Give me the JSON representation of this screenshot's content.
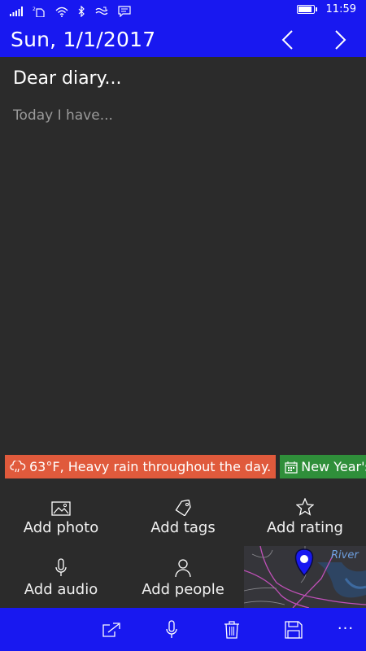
{
  "status_bar": {
    "time": "11:59",
    "icons": [
      "signal-icon",
      "sim-icon",
      "wifi-icon",
      "bluetooth-icon",
      "data-sense-icon",
      "message-icon",
      "battery-icon"
    ]
  },
  "header": {
    "date": "Sun, 1/1/2017",
    "prev_icon": "chevron-left-icon",
    "next_icon": "chevron-right-icon",
    "accent": "#1818f0"
  },
  "entry": {
    "title_placeholder": "Dear diary...",
    "body_placeholder": "Today I have..."
  },
  "chips": {
    "weather": "63°F, Heavy rain throughout the day.",
    "weather_color": "#e05a3c",
    "holiday": "New Year's Day",
    "holiday_color": "#2f8f3a"
  },
  "actions": {
    "photo": "Add photo",
    "tags": "Add tags",
    "rating": "Add rating",
    "audio": "Add audio",
    "people": "Add people"
  },
  "map": {
    "label": "River"
  },
  "app_bar": {
    "icons": [
      "share-icon",
      "microphone-icon",
      "delete-icon",
      "save-icon"
    ],
    "more": "..."
  }
}
